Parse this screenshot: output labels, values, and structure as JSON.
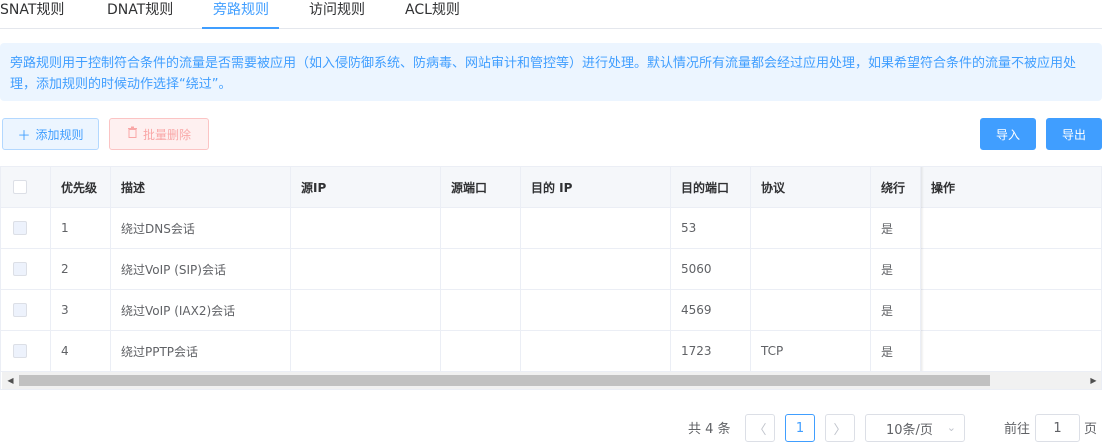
{
  "tabs": [
    {
      "label": "SNAT规则",
      "active": false
    },
    {
      "label": "DNAT规则",
      "active": false
    },
    {
      "label": "旁路规则",
      "active": true
    },
    {
      "label": "访问规则",
      "active": false
    },
    {
      "label": "ACL规则",
      "active": false
    }
  ],
  "alert": {
    "text": "旁路规则用于控制符合条件的流量是否需要被应用（如入侵防御系统、防病毒、网站审计和管控等）进行处理。默认情况所有流量都会经过应用处理，如果希望符合条件的流量不被应用处理，添加规则的时候动作选择“绕过”。"
  },
  "toolbar": {
    "add_label": "添加规则",
    "add_icon": "plus-icon",
    "batch_delete_label": "批量删除",
    "batch_delete_icon": "trash-icon",
    "import_label": "导入",
    "export_label": "导出"
  },
  "table": {
    "columns": [
      "优先级",
      "描述",
      "源IP",
      "源端口",
      "目的 IP",
      "目的端口",
      "协议",
      "绕行",
      "操作"
    ],
    "rows": [
      {
        "priority": "1",
        "desc": "绕过DNS会话",
        "src_ip": "",
        "src_port": "",
        "dst_ip": "",
        "dst_port": "53",
        "protocol": "",
        "bypass": "是",
        "ops": ""
      },
      {
        "priority": "2",
        "desc": "绕过VoIP (SIP)会话",
        "src_ip": "",
        "src_port": "",
        "dst_ip": "",
        "dst_port": "5060",
        "protocol": "",
        "bypass": "是",
        "ops": ""
      },
      {
        "priority": "3",
        "desc": "绕过VoIP (IAX2)会话",
        "src_ip": "",
        "src_port": "",
        "dst_ip": "",
        "dst_port": "4569",
        "protocol": "",
        "bypass": "是",
        "ops": ""
      },
      {
        "priority": "4",
        "desc": "绕过PPTP会话",
        "src_ip": "",
        "src_port": "",
        "dst_ip": "",
        "dst_port": "1723",
        "protocol": "TCP",
        "bypass": "是",
        "ops": ""
      }
    ]
  },
  "pagination": {
    "total_text": "共 4 条",
    "current_page": "1",
    "page_size": "10条/页",
    "goto_prefix": "前往",
    "goto_value": "1",
    "goto_suffix": "页"
  },
  "colors": {
    "accent": "#409eff",
    "alert_bg": "#ecf5ff",
    "danger_light": "#fef0f0"
  }
}
